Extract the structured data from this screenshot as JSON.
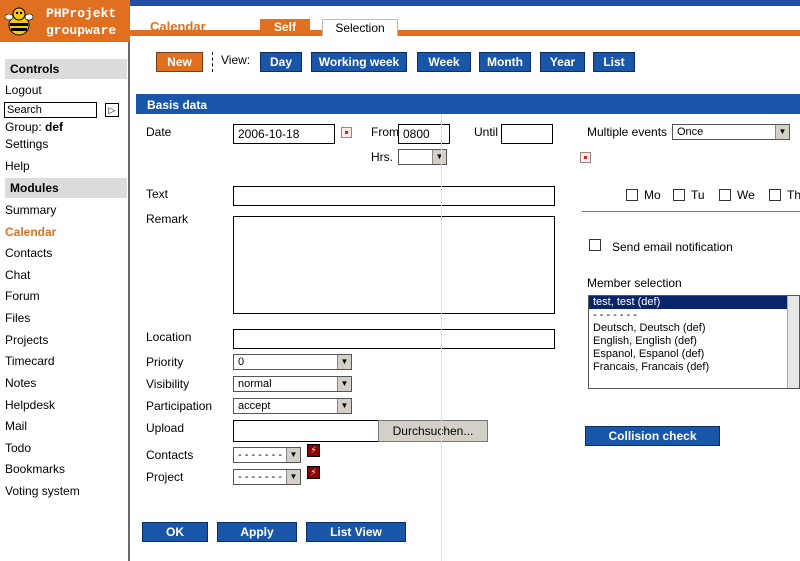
{
  "logo": {
    "line1": "PHProjekt",
    "line2": "groupware"
  },
  "tabs": {
    "module": "Calendar",
    "active": "Self",
    "other": "Selection"
  },
  "sidebar": {
    "controls_title": "Controls",
    "logout": "Logout",
    "search_value": "Search",
    "search_go": "▷",
    "group_label": "Group:",
    "group_value": "def",
    "settings": "Settings",
    "help": "Help",
    "modules_title": "Modules",
    "modules": [
      "Summary",
      "Calendar",
      "Contacts",
      "Chat",
      "Forum",
      "Files",
      "Projects",
      "Timecard",
      "Notes",
      "Helpdesk",
      "Mail",
      "Todo",
      "Bookmarks",
      "Voting system"
    ]
  },
  "toolbar": {
    "new": "New",
    "view_label": "View:",
    "views": [
      "Day",
      "Working week",
      "Week",
      "Month",
      "Year",
      "List"
    ]
  },
  "section": {
    "title": "Basis data"
  },
  "form": {
    "date_label": "Date",
    "date_value": "2006-10-18",
    "from_label": "From",
    "from_value": "0800",
    "until_label": "Until",
    "until_value": "",
    "hrs_label": "Hrs.",
    "hrs_value": "",
    "text_label": "Text",
    "remark_label": "Remark",
    "location_label": "Location",
    "priority_label": "Priority",
    "priority_value": "0",
    "visibility_label": "Visibility",
    "visibility_value": "normal",
    "participation_label": "Participation",
    "participation_value": "accept",
    "upload_label": "Upload",
    "browse_button": "Durchsuchen...",
    "contacts_label": "Contacts",
    "contacts_value": "- - - - - - -",
    "project_label": "Project",
    "project_value": "- - - - - - -"
  },
  "right": {
    "multiple_label": "Multiple events",
    "multiple_value": "Once",
    "weekdays": [
      "Mo",
      "Tu",
      "We",
      "Th"
    ],
    "email_label": "Send email notification",
    "member_label": "Member selection",
    "members": [
      "test, test (def)",
      "- - - - - - -",
      "Deutsch, Deutsch (def)",
      "English, English (def)",
      "Espanol, Espanol (def)",
      "Francais, Francais (def)"
    ],
    "collision_button": "Collision check"
  },
  "buttons": {
    "ok": "OK",
    "apply": "Apply",
    "list_view": "List View"
  }
}
